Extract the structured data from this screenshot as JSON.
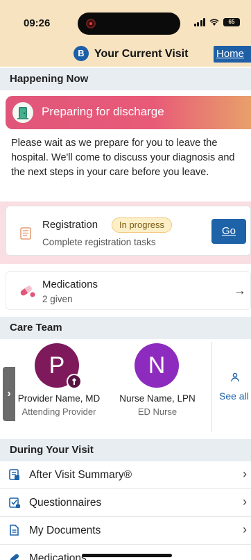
{
  "status_bar": {
    "time": "09:26",
    "battery": "65"
  },
  "header": {
    "badge_letter": "B",
    "title": "Your Current Visit",
    "home_link": "Home"
  },
  "happening_now": {
    "header": "Happening Now",
    "banner_text": "Preparing for discharge",
    "description": "Please wait as we prepare for you to leave the hospital. We'll come to discuss your diagnosis and the next steps in your care before you leave."
  },
  "registration": {
    "title": "Registration",
    "status_badge": "In progress",
    "subtitle": "Complete registration tasks",
    "go_button": "Go"
  },
  "medications_card": {
    "title": "Medications",
    "subtitle": "2 given",
    "arrow": "→"
  },
  "care_team": {
    "header": "Care Team",
    "handle": "›",
    "members": [
      {
        "initial": "P",
        "name": "Provider Name, MD",
        "role": "Attending Provider",
        "color": "#7e1a5c"
      },
      {
        "initial": "N",
        "name": "Nurse Name, LPN",
        "role": "ED Nurse",
        "color": "#8e2bbf"
      }
    ],
    "see_all": "See all"
  },
  "during_visit": {
    "header": "During Your Visit",
    "items": [
      {
        "label": "After Visit Summary®",
        "icon": "document-list-icon"
      },
      {
        "label": "Questionnaires",
        "icon": "checklist-icon"
      },
      {
        "label": "My Documents",
        "icon": "documents-icon"
      },
      {
        "label": "Medications",
        "icon": "pill-icon"
      }
    ],
    "chevron": "›"
  },
  "colors": {
    "header_bg": "#f8e3c1",
    "accent_blue": "#1e63a8",
    "discharge_pink": "#e0567a",
    "section_header_bg": "#e8edf2"
  }
}
